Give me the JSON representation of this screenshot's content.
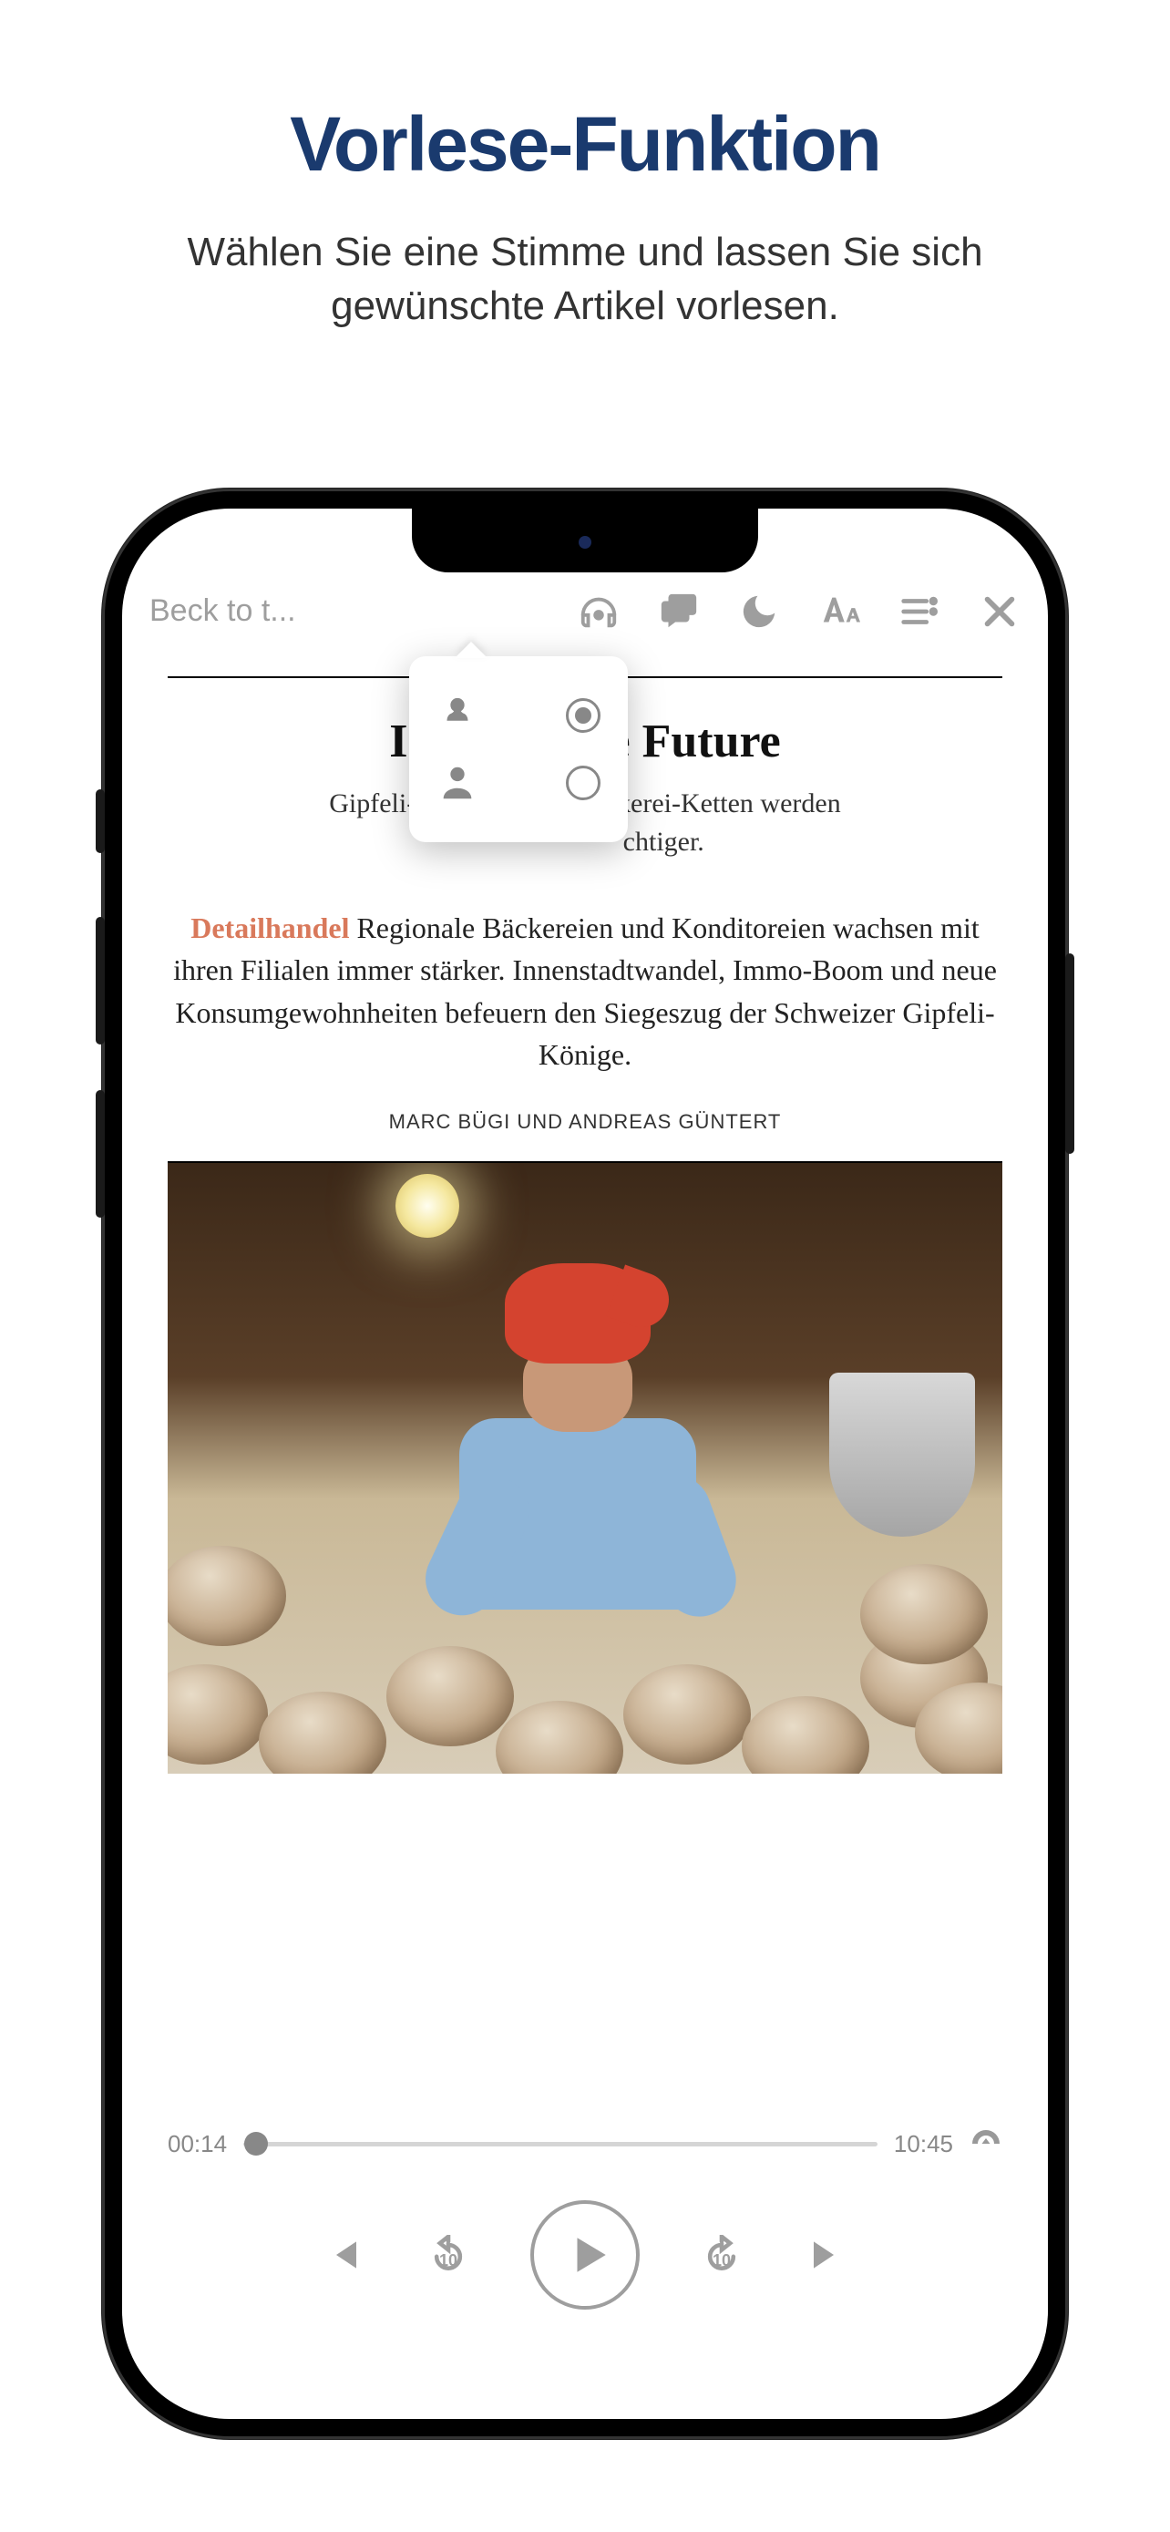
{
  "page": {
    "title": "Vorlese-Funktion",
    "subtitle": "Wählen Sie eine Stimme und lassen Sie sich gewünschte Artikel vorlesen."
  },
  "toolbar": {
    "back_label": "Beck to t..."
  },
  "voice_popover": {
    "options": [
      {
        "name": "female",
        "selected": true
      },
      {
        "name": "male",
        "selected": false
      }
    ]
  },
  "article": {
    "title_visible_left": "I",
    "title_visible_right": "e Future",
    "subtitle_left": "Gipfeli-Kön",
    "subtitle_right": "äckerei-Ketten werden",
    "subtitle_right2": "chtiger.",
    "lead_tag": "Detailhandel",
    "lead": " Regionale Bäckereien und Konditoreien wachsen mit ihren Filialen immer stärker. Innenstadtwandel, Immo-Boom und neue Konsumgewohnheiten befeuern den Siegeszug der Schweizer Gipfeli-Könige.",
    "author": "MARC BÜGI UND ANDREAS GÜNTERT"
  },
  "player": {
    "elapsed": "00:14",
    "total": "10:45",
    "skip_back": "10",
    "skip_fwd": "10"
  }
}
